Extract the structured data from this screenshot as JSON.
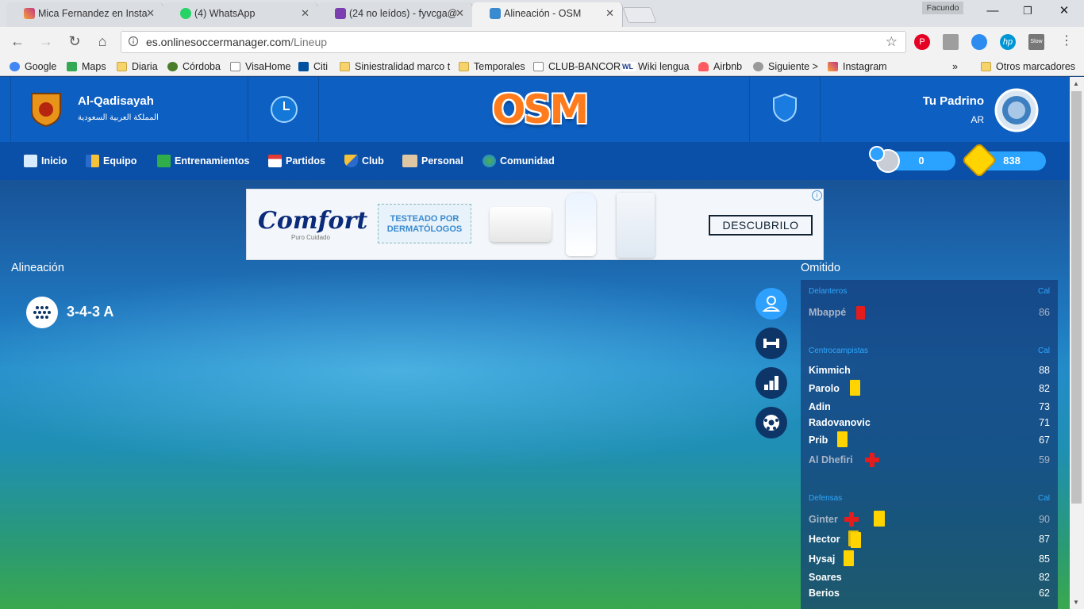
{
  "browser": {
    "tabs": [
      {
        "title": "Mica Fernandez en Insta",
        "icon": "instagram-icon"
      },
      {
        "title": "(4) WhatsApp",
        "icon": "whatsapp-icon"
      },
      {
        "title": "(24 no leídos) - fyvcga@",
        "icon": "mail-icon"
      },
      {
        "title": "Alineación - OSM",
        "icon": "osm-icon"
      }
    ],
    "close_glyph": "✕",
    "profile": "Facundo",
    "url_host": "es.onlinesoccermanager.com",
    "url_path": "/Lineup",
    "bookmarks": [
      "Google",
      "Maps",
      "Diaria",
      "Córdoba",
      "VisaHome",
      "Citi",
      "Siniestralidad marco t",
      "Temporales",
      "CLUB-BANCOR",
      "Wiki lengua",
      "Airbnb",
      "Siguiente >",
      "Instagram"
    ],
    "bookmarks_more": "»",
    "other_bookmarks": "Otros marcadores"
  },
  "header": {
    "club_name": "Al-Qadisayah",
    "club_country": "المملكة العربية السعودية",
    "logo": "OSM",
    "manager_name": "Tu Padrino",
    "manager_country": "AR"
  },
  "nav": {
    "items": [
      "Inicio",
      "Equipo",
      "Entrenamientos",
      "Partidos",
      "Club",
      "Personal",
      "Comunidad"
    ],
    "coins": "0",
    "bosscoins": "838"
  },
  "ad": {
    "brand": "Comfort",
    "brand_sub": "Puro Cuidado",
    "tested_line1": "TESTEADO POR",
    "tested_line2": "DERMATÓLOGOS",
    "cta": "DESCUBRILO",
    "info": "i"
  },
  "lineup": {
    "title": "Alineación",
    "formation": "3-4-3 A"
  },
  "omitted": {
    "title": "Omitido",
    "cal_label": "Cal",
    "groups": [
      {
        "name": "Delanteros",
        "players": [
          {
            "name": "Mbappé",
            "rating": "86",
            "status": "red",
            "dim": true
          }
        ]
      },
      {
        "name": "Centrocampistas",
        "players": [
          {
            "name": "Kimmich",
            "rating": "88",
            "status": "",
            "dim": false
          },
          {
            "name": "Parolo",
            "rating": "82",
            "status": "yellow",
            "dim": false
          },
          {
            "name": "Adin",
            "rating": "73",
            "status": "",
            "dim": false
          },
          {
            "name": "Radovanovic",
            "rating": "71",
            "status": "",
            "dim": false
          },
          {
            "name": "Prib",
            "rating": "67",
            "status": "yellow",
            "dim": false
          },
          {
            "name": "Al Dhefiri",
            "rating": "59",
            "status": "injury",
            "dim": true
          }
        ]
      },
      {
        "name": "Defensas",
        "players": [
          {
            "name": "Ginter",
            "rating": "90",
            "status": "injury+yellow",
            "dim": true
          },
          {
            "name": "Hector",
            "rating": "87",
            "status": "double-yellow",
            "dim": false
          },
          {
            "name": "Hysaj",
            "rating": "85",
            "status": "yellow",
            "dim": false
          },
          {
            "name": "Soares",
            "rating": "82",
            "status": "",
            "dim": false
          },
          {
            "name": "Berios",
            "rating": "62",
            "status": "",
            "dim": false
          }
        ]
      }
    ]
  },
  "colors": {
    "accent": "#2ea1ff",
    "header": "#0d5fc2",
    "nav": "#0a4fa8",
    "yellow_card": "#ffd400",
    "red_card": "#e51c1c"
  }
}
